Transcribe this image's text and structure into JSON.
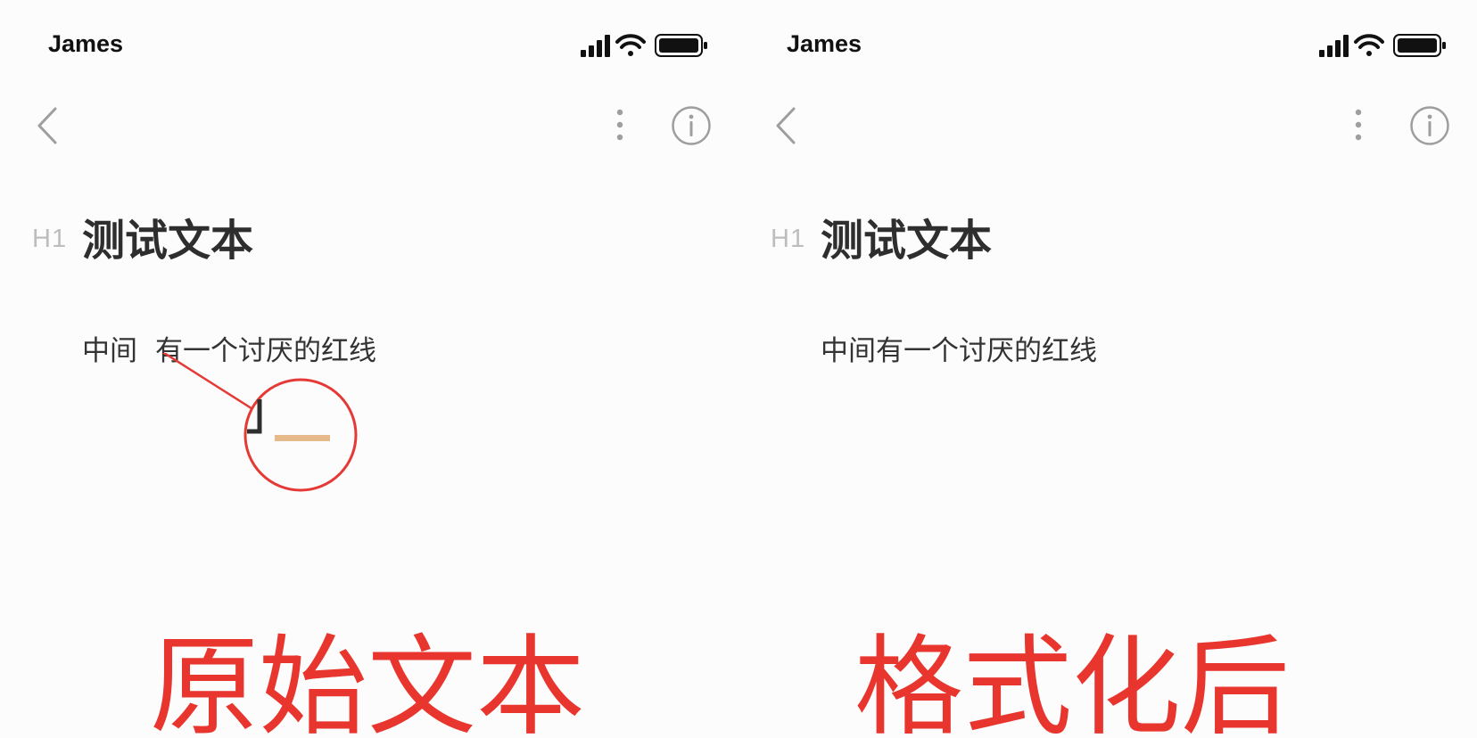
{
  "colors": {
    "background": "#fcfcfc",
    "caption": "#e8362f",
    "callout": "#e53935",
    "icon_gray": "#9e9e9e",
    "highlight_line": "#e6b98a"
  },
  "panels": [
    {
      "id": "original",
      "status_bar": {
        "carrier": "James",
        "icons": [
          "signal-icon",
          "wifi-icon",
          "battery-icon"
        ]
      },
      "toolbar": {
        "back": "back-icon",
        "more": "more-vertical-icon",
        "info": "info-icon"
      },
      "heading_marker": "H1",
      "heading": "测试文本",
      "paragraph_parts": [
        "中间",
        "有一个讨厌的红线"
      ],
      "caption": "原始文本"
    },
    {
      "id": "formatted",
      "status_bar": {
        "carrier": "James",
        "icons": [
          "signal-icon",
          "wifi-icon",
          "battery-icon"
        ]
      },
      "toolbar": {
        "back": "back-icon",
        "more": "more-vertical-icon",
        "info": "info-icon"
      },
      "heading_marker": "H1",
      "heading": "测试文本",
      "paragraph": "中间有一个讨厌的红线",
      "caption": "格式化后"
    }
  ]
}
